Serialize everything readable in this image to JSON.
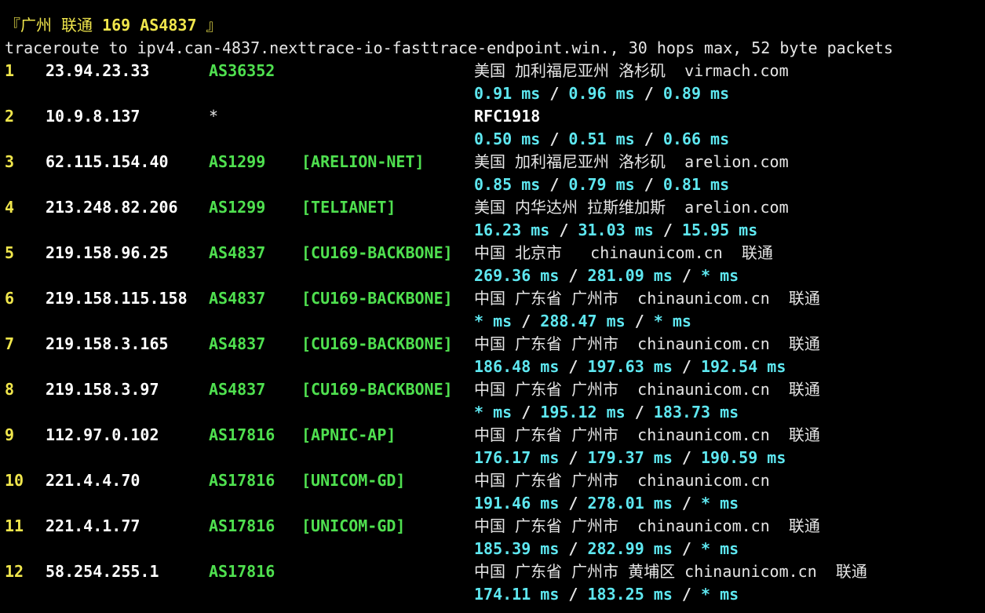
{
  "title": {
    "bracket_open": "『",
    "city": "广州",
    "carrier": "联通",
    "bold_part": "169 AS4837",
    "bracket_close": "』"
  },
  "header": "traceroute to ipv4.can-4837.nexttrace-io-fasttrace-endpoint.win., 30 hops max, 52 byte packets",
  "colors": {
    "background": "#000000",
    "hop_number": "#f0e64c",
    "ip": "#ffffff",
    "asn": "#4fe04f",
    "rtt": "#5ee7f0",
    "text": "#e6e6e6"
  },
  "hops": [
    {
      "num": "1",
      "ip": "23.94.23.33",
      "asn": "AS36352",
      "org": "",
      "geo": "美国 加利福尼亚州 洛杉矶  virmach.com",
      "rtt": [
        "0.91 ms",
        "0.96 ms",
        "0.89 ms"
      ]
    },
    {
      "num": "2",
      "ip": "10.9.8.137",
      "asn": "*",
      "org": "",
      "geo": "RFC1918",
      "rtt": [
        "0.50 ms",
        "0.51 ms",
        "0.66 ms"
      ]
    },
    {
      "num": "3",
      "ip": "62.115.154.40",
      "asn": "AS1299",
      "org": "[ARELION-NET]",
      "geo": "美国 加利福尼亚州 洛杉矶  arelion.com",
      "rtt": [
        "0.85 ms",
        "0.79 ms",
        "0.81 ms"
      ]
    },
    {
      "num": "4",
      "ip": "213.248.82.206",
      "asn": "AS1299",
      "org": "[TELIANET]",
      "geo": "美国 内华达州 拉斯维加斯  arelion.com",
      "rtt": [
        "16.23 ms",
        "31.03 ms",
        "15.95 ms"
      ]
    },
    {
      "num": "5",
      "ip": "219.158.96.25",
      "asn": "AS4837",
      "org": "[CU169-BACKBONE]",
      "geo": "中国 北京市   chinaunicom.cn  联通",
      "rtt": [
        "269.36 ms",
        "281.09 ms",
        "* ms"
      ]
    },
    {
      "num": "6",
      "ip": "219.158.115.158",
      "asn": "AS4837",
      "org": "[CU169-BACKBONE]",
      "geo": "中国 广东省 广州市  chinaunicom.cn  联通",
      "rtt": [
        "* ms",
        "288.47 ms",
        "* ms"
      ]
    },
    {
      "num": "7",
      "ip": "219.158.3.165",
      "asn": "AS4837",
      "org": "[CU169-BACKBONE]",
      "geo": "中国 广东省 广州市  chinaunicom.cn  联通",
      "rtt": [
        "186.48 ms",
        "197.63 ms",
        "192.54 ms"
      ]
    },
    {
      "num": "8",
      "ip": "219.158.3.97",
      "asn": "AS4837",
      "org": "[CU169-BACKBONE]",
      "geo": "中国 广东省 广州市  chinaunicom.cn  联通",
      "rtt": [
        "* ms",
        "195.12 ms",
        "183.73 ms"
      ]
    },
    {
      "num": "9",
      "ip": "112.97.0.102",
      "asn": "AS17816",
      "org": "[APNIC-AP]",
      "geo": "中国 广东省 广州市  chinaunicom.cn  联通",
      "rtt": [
        "176.17 ms",
        "179.37 ms",
        "190.59 ms"
      ]
    },
    {
      "num": "10",
      "ip": "221.4.4.70",
      "asn": "AS17816",
      "org": "[UNICOM-GD]",
      "geo": "中国 广东省 广州市  chinaunicom.cn",
      "rtt": [
        "191.46 ms",
        "278.01 ms",
        "* ms"
      ]
    },
    {
      "num": "11",
      "ip": "221.4.1.77",
      "asn": "AS17816",
      "org": "[UNICOM-GD]",
      "geo": "中国 广东省 广州市  chinaunicom.cn  联通",
      "rtt": [
        "185.39 ms",
        "282.99 ms",
        "* ms"
      ]
    },
    {
      "num": "12",
      "ip": "58.254.255.1",
      "asn": "AS17816",
      "org": "",
      "geo": "中国 广东省 广州市 黄埔区 chinaunicom.cn  联通",
      "rtt": [
        "174.11 ms",
        "183.25 ms",
        "* ms"
      ]
    }
  ],
  "rtt_separator": " / "
}
